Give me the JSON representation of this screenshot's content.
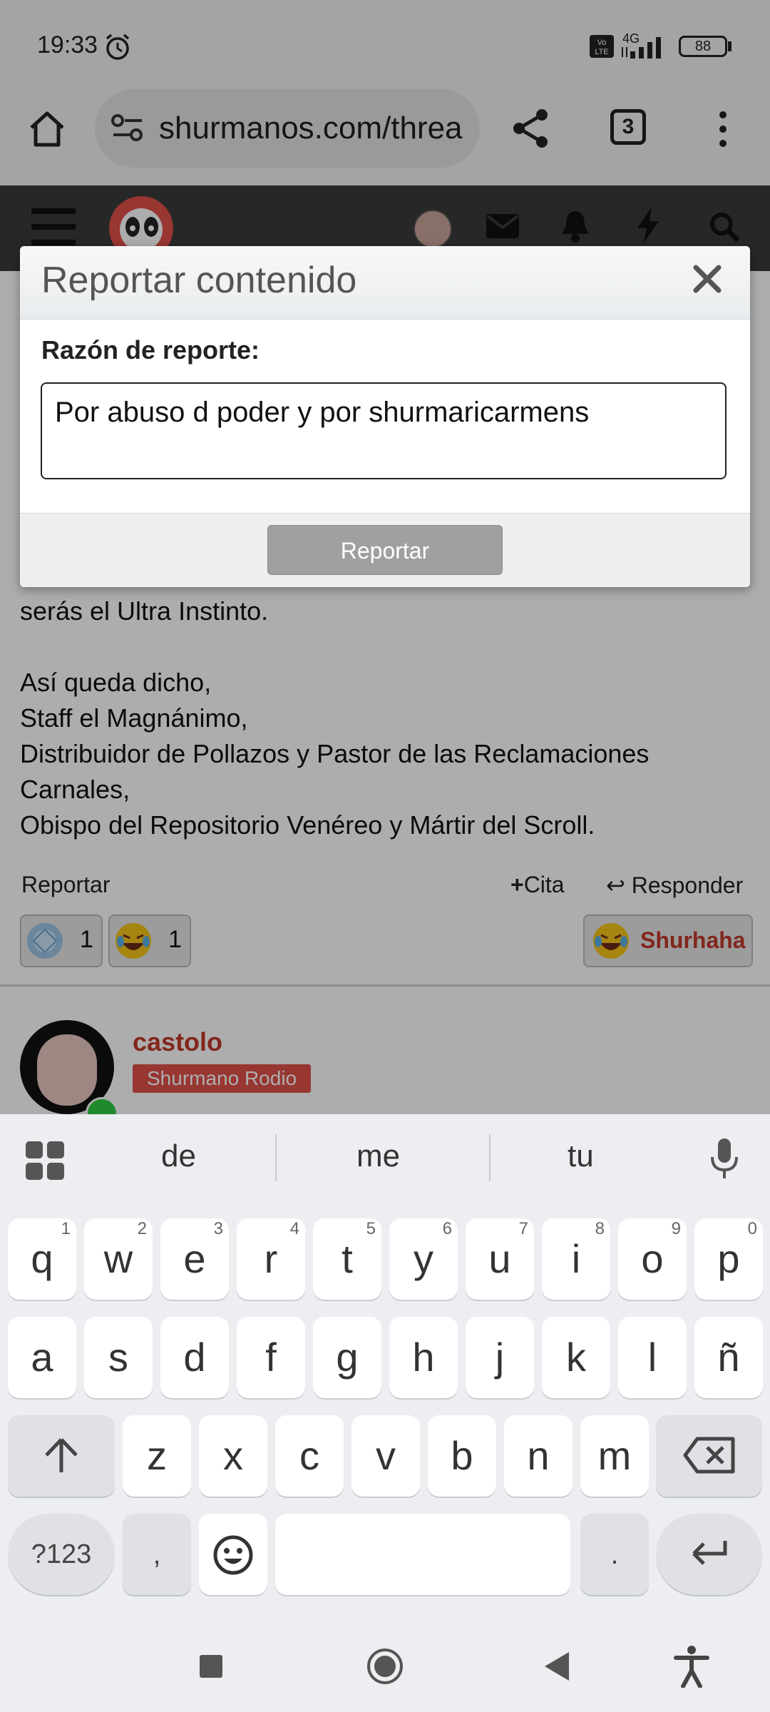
{
  "status": {
    "time": "19:33",
    "battery": "88",
    "network": "4G"
  },
  "browser": {
    "url": "shurmanos.com/threa",
    "tab_count": "3"
  },
  "post": {
    "lines": [
      "serás el Ultra Instinto.",
      "",
      "Así queda dicho,",
      "Staff el Magnánimo,",
      "Distribuidor de Pollazos y Pastor de las Reclamaciones",
      "Carnales,",
      "Obispo del Repositorio Venéreo y Mártir del Scroll."
    ],
    "report_link": "Reportar",
    "quote_label": "Cita",
    "reply_label": "Responder",
    "reactions": [
      {
        "icon": "crystal-ball-reaction-icon",
        "count": "1"
      },
      {
        "icon": "laughing-face-reaction-icon",
        "count": "1"
      }
    ],
    "react_button": "Shurhaha"
  },
  "next_post": {
    "username": "castolo",
    "user_title": "Shurmano Rodio"
  },
  "dialog": {
    "title": "Reportar contenido",
    "reason_label": "Razón de reporte:",
    "reason_value": "Por abuso d poder y por shurmaricarmens",
    "submit_label": "Reportar"
  },
  "keyboard": {
    "suggestions": [
      "de",
      "me",
      "tu"
    ],
    "row1": [
      {
        "k": "q",
        "h": "1"
      },
      {
        "k": "w",
        "h": "2"
      },
      {
        "k": "e",
        "h": "3"
      },
      {
        "k": "r",
        "h": "4"
      },
      {
        "k": "t",
        "h": "5"
      },
      {
        "k": "y",
        "h": "6"
      },
      {
        "k": "u",
        "h": "7"
      },
      {
        "k": "i",
        "h": "8"
      },
      {
        "k": "o",
        "h": "9"
      },
      {
        "k": "p",
        "h": "0"
      }
    ],
    "row2": [
      "a",
      "s",
      "d",
      "f",
      "g",
      "h",
      "j",
      "k",
      "l",
      "ñ"
    ],
    "row3": [
      "z",
      "x",
      "c",
      "v",
      "b",
      "n",
      "m"
    ],
    "symbols_key": "?123",
    "comma_key": ",",
    "period_key": "."
  },
  "colors": {
    "accent_red": "#e0504a",
    "username": "#c0392b",
    "dialog_button": "#9ea0a2"
  }
}
